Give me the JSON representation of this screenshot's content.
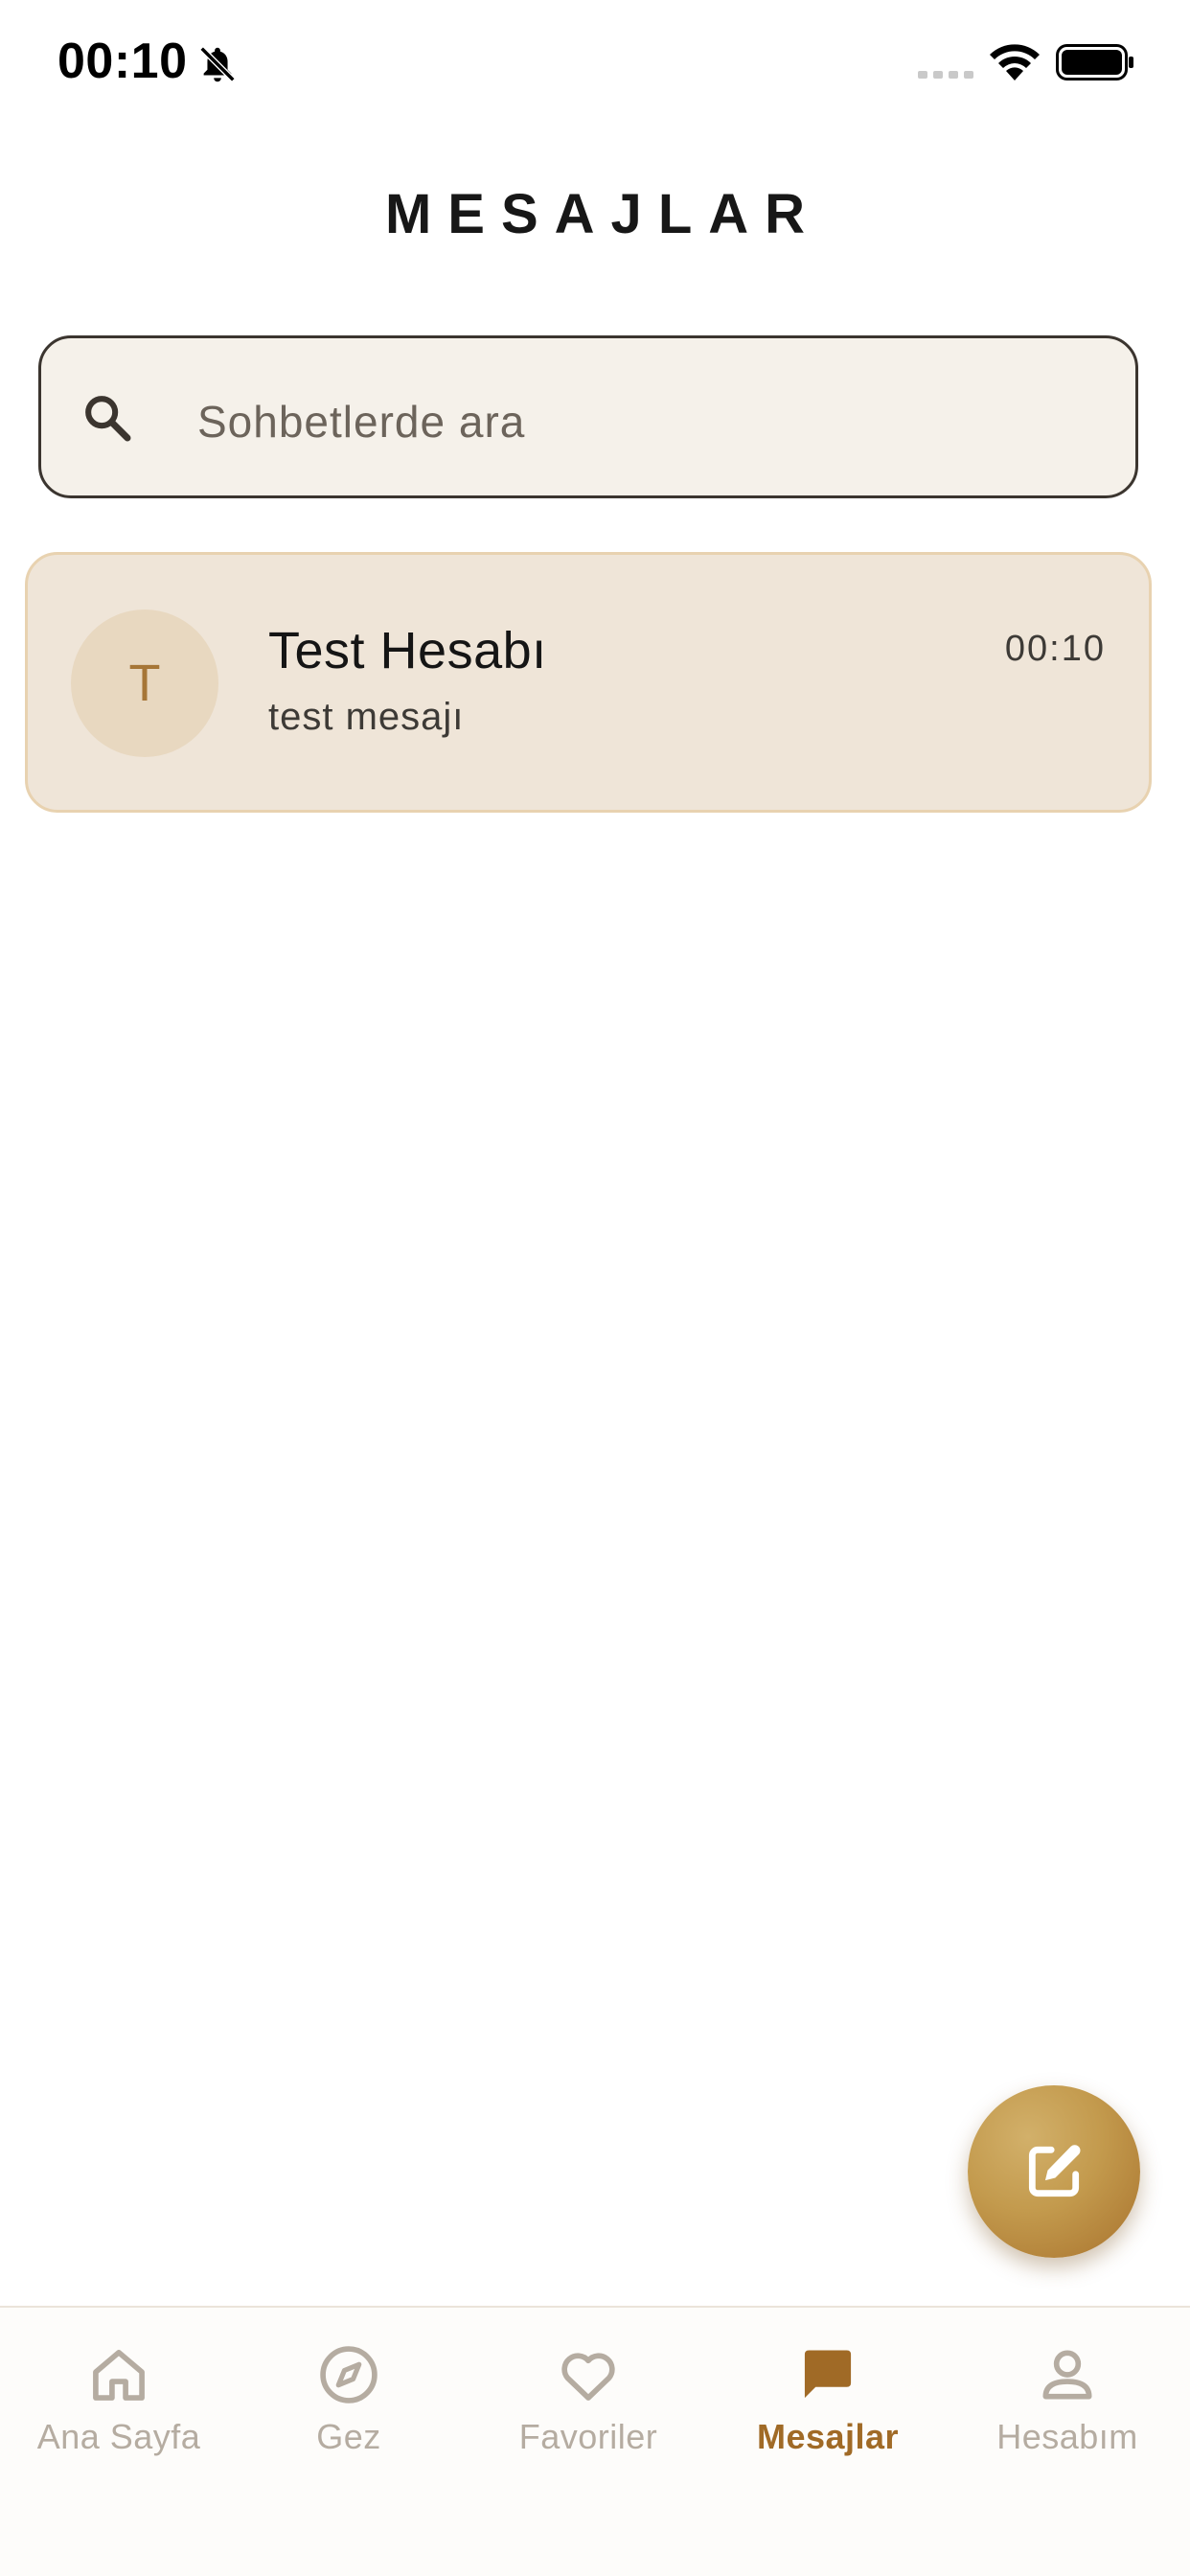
{
  "status_bar": {
    "time": "00:10",
    "icons": [
      "bell-off-icon",
      "signal-icon",
      "wifi-icon",
      "battery-icon"
    ]
  },
  "header": {
    "title": "MESAJLAR"
  },
  "search": {
    "placeholder": "Sohbetlerde ara",
    "value": "",
    "icon": "search-icon"
  },
  "conversations": [
    {
      "avatar_initial": "T",
      "name": "Test Hesabı",
      "last_message": "test mesajı",
      "time": "00:10"
    }
  ],
  "fab": {
    "icon": "edit-icon"
  },
  "bottom_nav": {
    "items": [
      {
        "label": "Ana Sayfa",
        "icon": "home-icon",
        "active": false
      },
      {
        "label": "Gez",
        "icon": "compass-icon",
        "active": false
      },
      {
        "label": "Favoriler",
        "icon": "heart-icon",
        "active": false
      },
      {
        "label": "Mesajlar",
        "icon": "chat-icon",
        "active": true
      },
      {
        "label": "Hesabım",
        "icon": "person-icon",
        "active": false
      }
    ]
  },
  "colors": {
    "accent": "#a06a26",
    "card_background": "#efe5d8",
    "card_border": "#e8d2b0",
    "search_background": "#f5f1ea",
    "inactive_nav": "#b5aca1"
  }
}
